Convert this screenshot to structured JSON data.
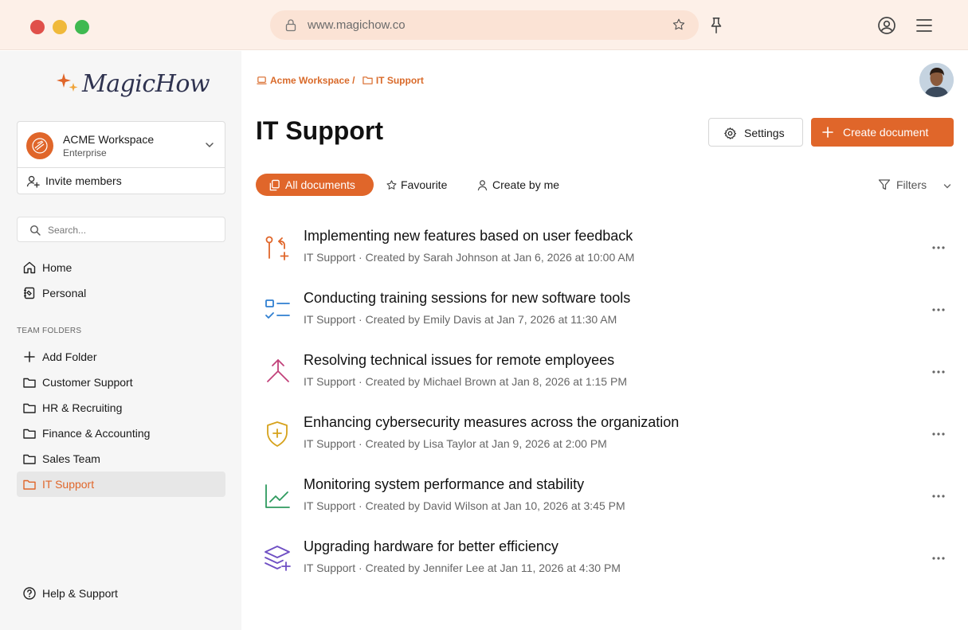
{
  "browser": {
    "url": "www.magichow.co"
  },
  "brand": {
    "name": "MagicHow",
    "accent": "#e0662a"
  },
  "workspace": {
    "name": "ACME Workspace",
    "plan": "Enterprise",
    "invite_label": "Invite members"
  },
  "search": {
    "placeholder": "Search..."
  },
  "nav": [
    {
      "label": "Home",
      "icon": "home-icon"
    },
    {
      "label": "Personal",
      "icon": "notebook-icon"
    }
  ],
  "team_folders": {
    "heading": "TEAM FOLDERS",
    "add_label": "Add Folder",
    "items": [
      "Customer Support",
      "HR & Recruiting",
      "Finance & Accounting",
      "Sales Team",
      "IT Support"
    ],
    "active": "IT Support"
  },
  "help_label": "Help & Support",
  "breadcrumb": {
    "root": "Acme Workspace /",
    "current": "IT Support"
  },
  "page": {
    "title": "IT Support",
    "settings_label": "Settings",
    "create_label": "Create document"
  },
  "tabs": [
    {
      "label": "All documents",
      "active": true
    },
    {
      "label": "Favourite",
      "active": false
    },
    {
      "label": "Create by me",
      "active": false
    }
  ],
  "filters_label": "Filters",
  "documents": [
    {
      "title": "Implementing new features based on user feedback",
      "folder": "IT Support",
      "created": "Created by Sarah Johnson at Jan 6, 2026 at 10:00 AM",
      "icon": "git-merge-icon",
      "color": "#e0662a"
    },
    {
      "title": "Conducting training sessions for new software tools",
      "folder": "IT Support",
      "created": "Created by Emily Davis at Jan 7, 2026 at 11:30 AM",
      "icon": "checklist-icon",
      "color": "#2f7fd1"
    },
    {
      "title": "Resolving technical issues for remote employees",
      "folder": "IT Support",
      "created": "Created by Michael Brown at Jan 8, 2026 at 1:15 PM",
      "icon": "split-arrow-icon",
      "color": "#c2427a"
    },
    {
      "title": "Enhancing cybersecurity measures across the organization",
      "folder": "IT Support",
      "created": "Created by Lisa Taylor at Jan 9, 2026 at 2:00 PM",
      "icon": "shield-plus-icon",
      "color": "#d6a21c"
    },
    {
      "title": "Monitoring system performance and stability",
      "folder": "IT Support",
      "created": "Created by David Wilson at Jan 10, 2026 at 3:45 PM",
      "icon": "line-chart-icon",
      "color": "#2e9a5e"
    },
    {
      "title": "Upgrading hardware for better efficiency",
      "folder": "IT Support",
      "created": "Created by Jennifer Lee at Jan 11, 2026 at 4:30 PM",
      "icon": "layers-plus-icon",
      "color": "#6f4fc4"
    }
  ]
}
